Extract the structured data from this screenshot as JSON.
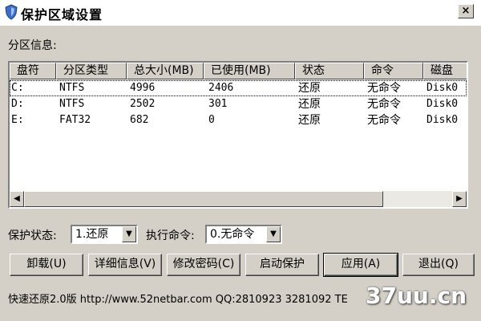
{
  "window": {
    "title": "保护区域设置",
    "close_glyph": "×"
  },
  "partition_section": {
    "label": "分区信息:"
  },
  "table": {
    "columns": [
      "盘符",
      "分区类型",
      "总大小(MB)",
      "已使用(MB)",
      "状态",
      "命令",
      "磁盘"
    ],
    "rows": [
      [
        "C:",
        "NTFS",
        "4996",
        "2406",
        "还原",
        "无命令",
        "Disk0"
      ],
      [
        "D:",
        "NTFS",
        "2502",
        "301",
        "还原",
        "无命令",
        "Disk0"
      ],
      [
        "E:",
        "FAT32",
        "682",
        "0",
        "还原",
        "无命令",
        "Disk0"
      ]
    ]
  },
  "scrollbar": {
    "left_glyph": "◀",
    "right_glyph": "▶"
  },
  "controls": {
    "protect_state_label": "保护状态:",
    "protect_state_value": "1.还原",
    "exec_cmd_label": "执行命令:",
    "exec_cmd_value": "0.无命令",
    "dropdown_glyph": "▼"
  },
  "buttons": {
    "unload": "卸载(U)",
    "details": "详细信息(V)",
    "change_password": "修改密码(C)",
    "start_protect": "启动保护",
    "apply": "应用(A)",
    "exit": "退出(Q)"
  },
  "footer": {
    "text": "快速还原2.0版 http://www.52netbar.com QQ:2810923 3281092 TE",
    "watermark": "37uu.cn"
  },
  "colors": {
    "face": "#d4d0c8",
    "white": "#ffffff",
    "shadow": "#808080"
  }
}
